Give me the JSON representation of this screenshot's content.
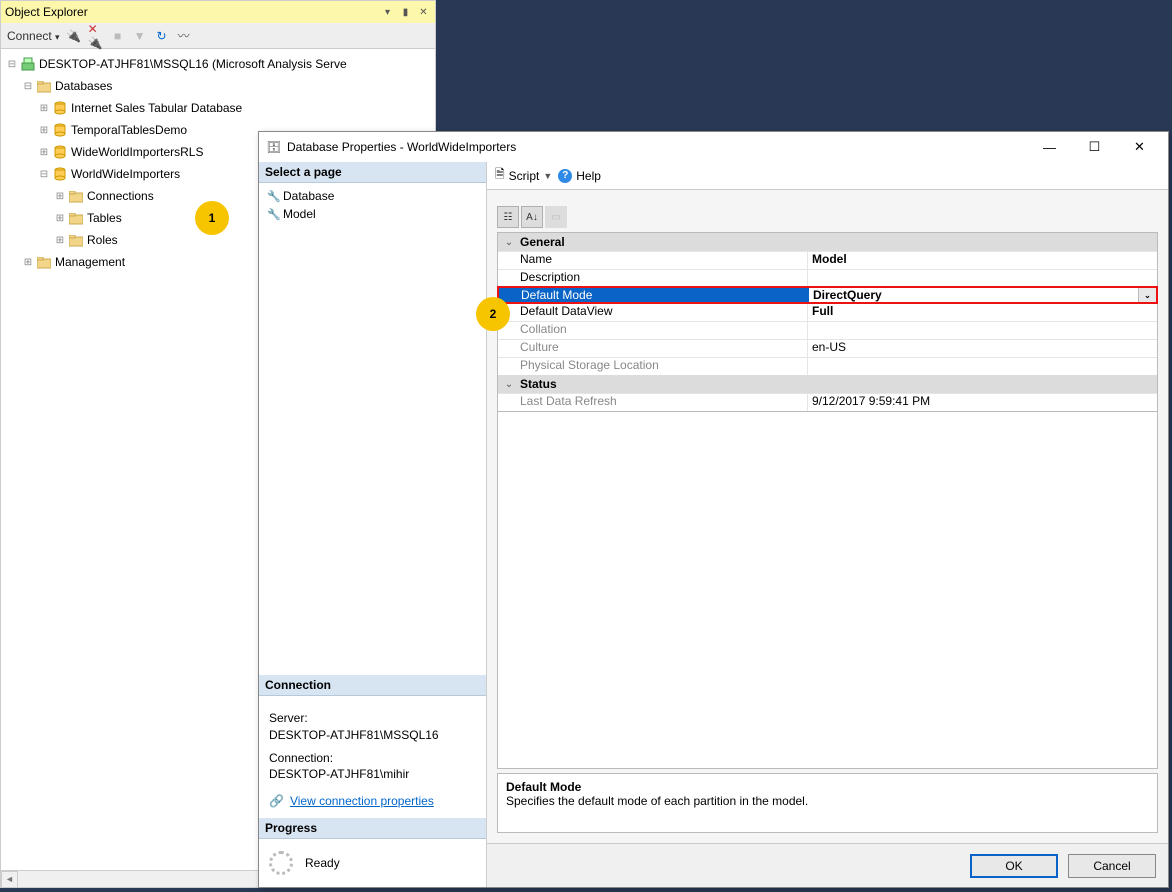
{
  "explorer": {
    "title": "Object Explorer",
    "toolbar": {
      "connect": "Connect"
    },
    "server_label": "DESKTOP-ATJHF81\\MSSQL16 (Microsoft Analysis Serve",
    "databases_label": "Databases",
    "management_label": "Management",
    "databases": [
      {
        "name": "Internet Sales Tabular Database"
      },
      {
        "name": "TemporalTablesDemo"
      },
      {
        "name": "WideWorldImportersRLS"
      },
      {
        "name": "WorldWideImporters"
      }
    ],
    "wwi_children": [
      {
        "name": "Connections"
      },
      {
        "name": "Tables"
      },
      {
        "name": "Roles"
      }
    ]
  },
  "annotations": {
    "one": "1",
    "two": "2"
  },
  "dialog": {
    "title": "Database Properties - WorldWideImporters",
    "select_page": "Select a page",
    "pages": [
      {
        "label": "Database"
      },
      {
        "label": "Model"
      }
    ],
    "connection_header": "Connection",
    "connection": {
      "server_label": "Server:",
      "server_value": "DESKTOP-ATJHF81\\MSSQL16",
      "connection_label": "Connection:",
      "connection_value": "DESKTOP-ATJHF81\\mihir",
      "view_link": "View connection properties"
    },
    "progress_header": "Progress",
    "progress_status": "Ready",
    "script_label": "Script",
    "help_label": "Help",
    "properties": {
      "general_section": "General",
      "name": {
        "label": "Name",
        "value": "Model"
      },
      "description": {
        "label": "Description",
        "value": ""
      },
      "default_mode": {
        "label": "Default Mode",
        "value": "DirectQuery"
      },
      "default_dataview": {
        "label": "Default DataView",
        "value": "Full"
      },
      "collation": {
        "label": "Collation",
        "value": ""
      },
      "culture": {
        "label": "Culture",
        "value": "en-US"
      },
      "storage_location": {
        "label": "Physical Storage Location",
        "value": ""
      },
      "status_section": "Status",
      "last_refresh": {
        "label": "Last Data Refresh",
        "value": "9/12/2017 9:59:41 PM"
      }
    },
    "description": {
      "title": "Default Mode",
      "text": "Specifies the default mode of each partition in the model."
    },
    "buttons": {
      "ok": "OK",
      "cancel": "Cancel"
    }
  }
}
